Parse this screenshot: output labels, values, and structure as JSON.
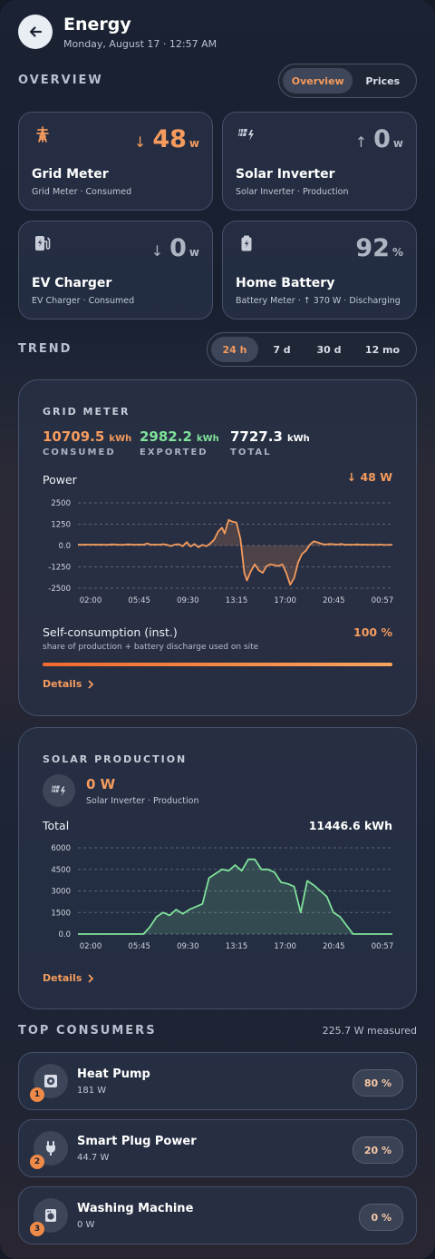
{
  "header": {
    "title": "Energy",
    "subtitle": "Monday, August 17 · 12:57 AM"
  },
  "overview": {
    "label": "OVERVIEW",
    "tabs": [
      {
        "label": "Overview",
        "active": true
      },
      {
        "label": "Prices",
        "active": false
      }
    ],
    "tiles": [
      {
        "icon": "transmission-tower-icon",
        "direction": "↓",
        "value": "48",
        "unit": "w",
        "name": "Grid Meter",
        "desc": "Grid Meter · Consumed",
        "accent": "#f59b5d"
      },
      {
        "icon": "solar-panel-icon",
        "direction": "↑",
        "value": "0",
        "unit": "w",
        "name": "Solar Inverter",
        "desc": "Solar Inverter · Production",
        "accent": "#aeb5c2"
      },
      {
        "icon": "ev-station-icon",
        "direction": "↓",
        "value": "0",
        "unit": "w",
        "name": "EV Charger",
        "desc": "EV Charger · Consumed",
        "accent": "#aeb5c2"
      },
      {
        "icon": "battery-icon",
        "direction": "",
        "value": "92",
        "unit": "%",
        "name": "Home Battery",
        "desc": "Battery Meter · ↑ 370 W · Discharging",
        "accent": "#aeb5c2"
      }
    ]
  },
  "trend": {
    "label": "TREND",
    "ranges": [
      {
        "label": "24 h",
        "active": true
      },
      {
        "label": "7 d",
        "active": false
      },
      {
        "label": "30 d",
        "active": false
      },
      {
        "label": "12 mo",
        "active": false
      }
    ]
  },
  "grid_card": {
    "title": "GRID METER",
    "consumed": {
      "value": "10709.5",
      "unit": "kWh",
      "label": "CONSUMED"
    },
    "exported": {
      "value": "2982.2",
      "unit": "kWh",
      "label": "EXPORTED"
    },
    "total": {
      "value": "7727.3",
      "unit": "kWh",
      "label": "TOTAL"
    },
    "power_label": "Power",
    "power_value": "↓ 48 W",
    "self_label": "Self-consumption (inst.)",
    "self_value": "100 %",
    "self_fraction": 1.0,
    "self_note": "share of production + battery discharge used on site",
    "details": "Details"
  },
  "solar_card": {
    "title": "SOLAR PRODUCTION",
    "power": "0 W",
    "source": "Solar Inverter · Production",
    "total_label": "Total",
    "total_value": "11446.6 kWh",
    "details": "Details"
  },
  "consumers": {
    "label": "TOP CONSUMERS",
    "measured": "225.7 W measured",
    "items": [
      {
        "rank": "1",
        "icon": "heat-pump-icon",
        "name": "Heat Pump",
        "watts": "181 W",
        "pct": "80 %"
      },
      {
        "rank": "2",
        "icon": "power-plug-icon",
        "name": "Smart Plug Power",
        "watts": "44.7 W",
        "pct": "20 %"
      },
      {
        "rank": "3",
        "icon": "washing-machine-icon",
        "name": "Washing Machine",
        "watts": "0 W",
        "pct": "0 %"
      }
    ]
  },
  "chart_data": [
    {
      "type": "line",
      "title": "",
      "xlabel": "",
      "ylabel": "",
      "x_ticks": [
        "02:00",
        "05:45",
        "09:30",
        "13:15",
        "17:00",
        "20:45",
        "00:57"
      ],
      "y_ticks": [
        "2500",
        "1250",
        "0.0",
        "-1250",
        "-2500"
      ],
      "ylim": [
        -2500,
        2500
      ],
      "grid": true,
      "color": "#f59b5d",
      "series": [
        {
          "x": [
            0.0,
            0.3,
            0.6,
            0.9,
            1.2,
            1.5,
            1.8,
            2.0,
            2.3,
            2.6,
            2.9,
            3.2,
            3.5,
            3.8,
            4.1,
            4.4,
            4.7,
            5.0,
            5.3,
            5.6,
            5.9,
            6.2,
            6.5,
            6.8,
            7.1,
            7.4,
            7.7,
            8.0,
            8.3,
            8.6,
            8.9,
            9.2,
            9.5,
            9.8,
            10.1,
            10.4,
            10.7,
            11.0,
            11.2,
            11.5,
            11.8,
            12.1,
            12.4,
            12.7,
            12.9,
            13.2,
            13.5,
            13.8,
            14.1,
            14.4,
            14.7,
            15.0,
            15.3,
            15.6,
            15.9,
            16.2,
            16.5,
            16.8,
            17.1,
            17.4,
            17.7,
            18.0,
            18.3,
            18.6,
            18.9,
            19.2,
            19.5,
            19.8,
            20.1,
            20.4,
            20.7,
            21.0,
            21.3,
            21.6,
            21.9,
            22.2,
            22.5,
            22.8,
            23.1,
            23.4,
            23.7,
            24.0
          ],
          "y": [
            60,
            40,
            60,
            50,
            60,
            40,
            60,
            50,
            40,
            70,
            60,
            40,
            50,
            70,
            60,
            40,
            60,
            50,
            120,
            40,
            60,
            50,
            80,
            40,
            -30,
            60,
            80,
            -40,
            200,
            -60,
            90,
            -100,
            40,
            -40,
            120,
            350,
            820,
            1050,
            700,
            1500,
            1400,
            1350,
            400,
            -1600,
            -2050,
            -1500,
            -1100,
            -1450,
            -1600,
            -1200,
            -1100,
            -1150,
            -1200,
            -1100,
            -1600,
            -2300,
            -1900,
            -1000,
            -500,
            -300,
            50,
            250,
            180,
            100,
            60,
            90,
            80,
            60,
            90,
            40,
            60,
            50,
            70,
            40,
            60,
            50,
            40,
            50,
            60,
            30,
            50,
            48
          ]
        }
      ]
    },
    {
      "type": "area",
      "title": "",
      "xlabel": "",
      "ylabel": "",
      "x_ticks": [
        "02:00",
        "05:45",
        "09:30",
        "13:15",
        "17:00",
        "20:45",
        "00:57"
      ],
      "y_ticks": [
        "6000",
        "4500",
        "3000",
        "1500",
        "0.0"
      ],
      "ylim": [
        0,
        6000
      ],
      "grid": true,
      "color": "#7fe29a",
      "series": [
        {
          "x": [
            0,
            1,
            2,
            3,
            4,
            5,
            5.5,
            6,
            6.5,
            7,
            7.5,
            8,
            8.5,
            9,
            9.5,
            10,
            10.5,
            11,
            11.5,
            12,
            12.5,
            13,
            13.5,
            14,
            14.5,
            15,
            15.5,
            16,
            16.5,
            17,
            17.5,
            18,
            18.5,
            19,
            19.5,
            20,
            20.5,
            21,
            22,
            23,
            24
          ],
          "y": [
            0,
            0,
            0,
            0,
            0,
            0,
            500,
            1200,
            1500,
            1300,
            1700,
            1400,
            1700,
            1900,
            2100,
            3900,
            4200,
            4500,
            4400,
            4800,
            4400,
            5200,
            5200,
            4500,
            4500,
            4300,
            3600,
            3500,
            3300,
            1500,
            3700,
            3400,
            3000,
            2600,
            1500,
            1200,
            600,
            0,
            0,
            0,
            0
          ]
        }
      ]
    }
  ]
}
